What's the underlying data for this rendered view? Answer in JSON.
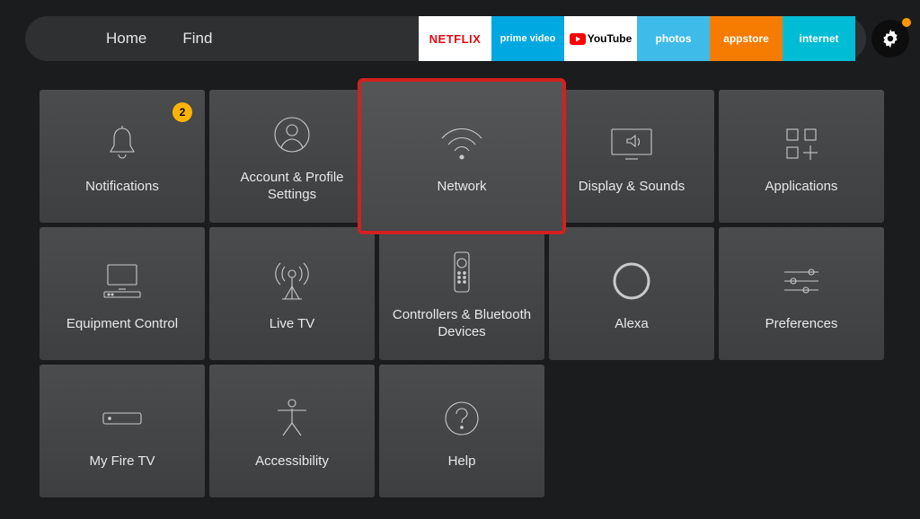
{
  "nav": {
    "home": "Home",
    "find": "Find"
  },
  "apps": {
    "netflix": "NETFLIX",
    "primevideo": "prime video",
    "youtube": "YouTube",
    "photos": "photos",
    "appstore": "appstore",
    "internet": "internet"
  },
  "settings": {
    "notifications": {
      "label": "Notifications",
      "badge": "2"
    },
    "account": {
      "label": "Account & Profile Settings"
    },
    "network": {
      "label": "Network"
    },
    "display": {
      "label": "Display & Sounds"
    },
    "applications": {
      "label": "Applications"
    },
    "equipment": {
      "label": "Equipment Control"
    },
    "livetv": {
      "label": "Live TV"
    },
    "controllers": {
      "label": "Controllers & Bluetooth Devices"
    },
    "alexa": {
      "label": "Alexa"
    },
    "preferences": {
      "label": "Preferences"
    },
    "myfiretv": {
      "label": "My Fire TV"
    },
    "accessibility": {
      "label": "Accessibility"
    },
    "help": {
      "label": "Help"
    }
  },
  "selected": "network"
}
